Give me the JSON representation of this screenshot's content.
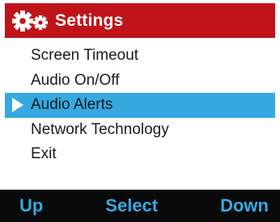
{
  "header": {
    "title": "Settings",
    "icon": "gears-icon",
    "background_color": "#c0141b"
  },
  "menu": {
    "items": [
      {
        "label": "Screen Timeout",
        "selected": false
      },
      {
        "label": "Audio On/Off",
        "selected": false
      },
      {
        "label": "Audio Alerts",
        "selected": true
      },
      {
        "label": "Network Technology",
        "selected": false
      },
      {
        "label": "Exit",
        "selected": false
      }
    ],
    "selection_color": "#36a9e1",
    "selection_pointer_icon": "right-triangle-icon"
  },
  "softkeys": {
    "left_label": "Up",
    "center_label": "Select",
    "right_label": "Down",
    "label_color": "#36a9e1",
    "background_color": "#0a0a0a"
  }
}
